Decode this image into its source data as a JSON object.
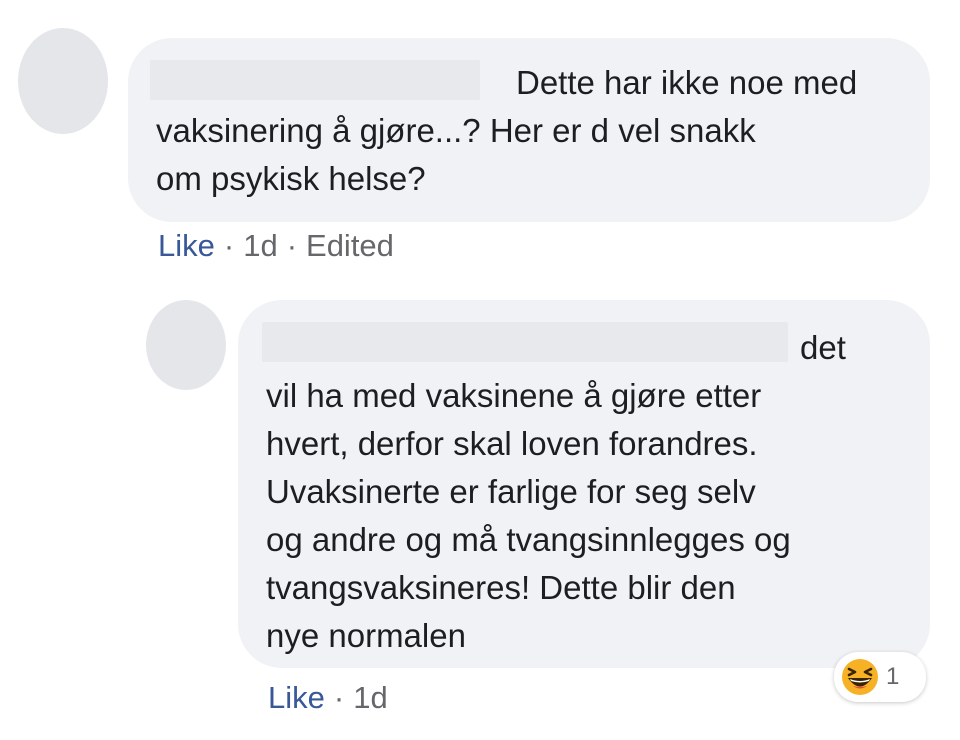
{
  "comments": [
    {
      "text_lines": [
        "Dette har ikke noe med",
        "vaksinering å gjøre...? Her er d vel snakk",
        "om psykisk helse?"
      ],
      "actions": {
        "like": "Like",
        "time": "1d",
        "edited": "Edited",
        "separator": "·"
      }
    }
  ],
  "reply": {
    "text_lines": [
      "det",
      "vil ha med vaksinene å gjøre etter",
      "hvert, derfor skal loven forandres.",
      "Uvaksinerte er farlige for seg selv",
      "og andre og må tvangsinnlegges og",
      "tvangsvaksineres! Dette blir den",
      "nye normalen"
    ],
    "actions": {
      "like": "Like",
      "time": "1d",
      "separator": "·"
    },
    "reaction": {
      "icon": "laughing-emoji-icon",
      "count": "1"
    }
  },
  "colors": {
    "bubble": "#f0f2f5",
    "like_link": "#385898",
    "meta_text": "#65676b",
    "avatar_placeholder": "#e4e6ea",
    "emoji_face": "#f7b125"
  }
}
